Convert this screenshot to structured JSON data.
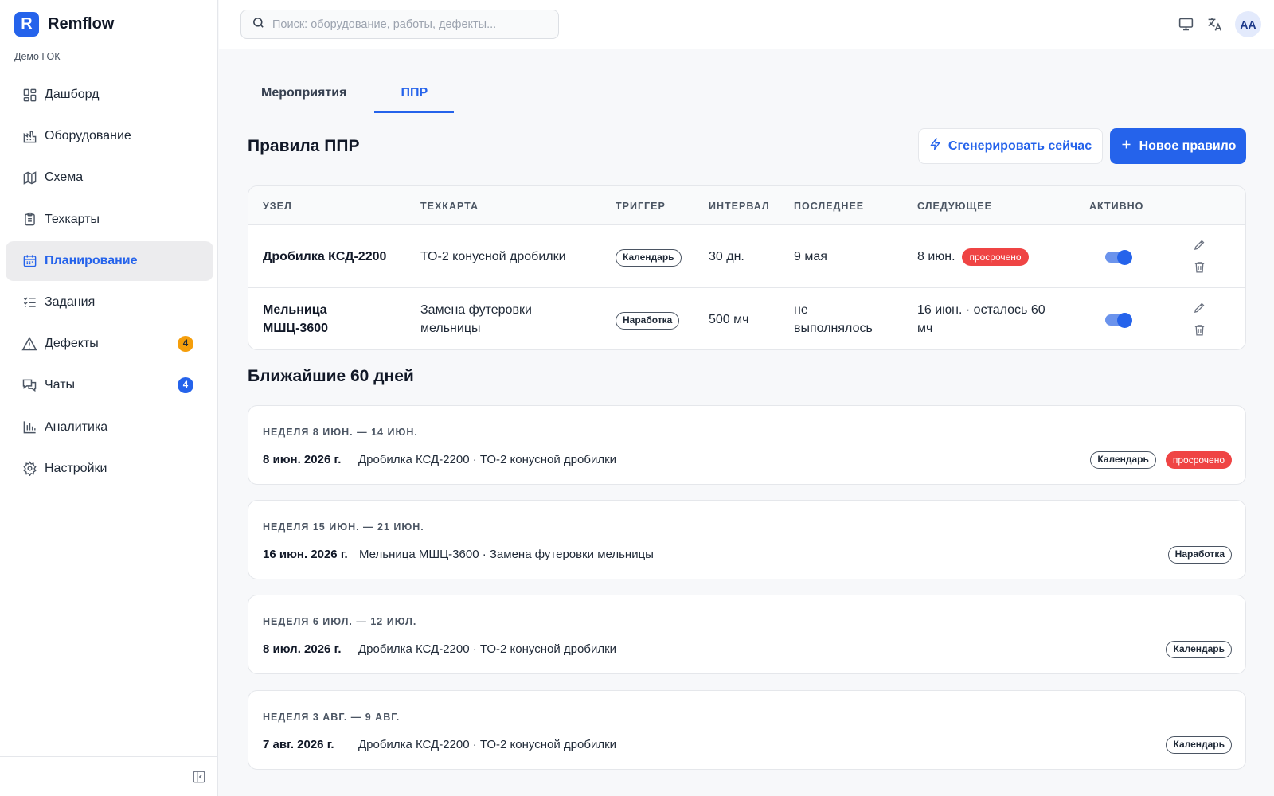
{
  "app": {
    "logo_letter": "R",
    "name": "Remflow",
    "org": "Демо ГОК"
  },
  "sidebar": {
    "items": [
      {
        "label": "Дашборд",
        "icon": "dashboard-icon"
      },
      {
        "label": "Оборудование",
        "icon": "factory-icon"
      },
      {
        "label": "Схема",
        "icon": "map-icon"
      },
      {
        "label": "Техкарты",
        "icon": "clipboard-icon"
      },
      {
        "label": "Планирование",
        "icon": "calendar-icon",
        "active": true
      },
      {
        "label": "Задания",
        "icon": "checklist-icon"
      },
      {
        "label": "Дефекты",
        "icon": "warning-icon",
        "badge": "4"
      },
      {
        "label": "Чаты",
        "icon": "chat-icon",
        "badge": "4"
      },
      {
        "label": "Аналитика",
        "icon": "bar-chart-icon"
      },
      {
        "label": "Настройки",
        "icon": "gear-icon"
      }
    ]
  },
  "header": {
    "search_placeholder": "Поиск: оборудование, работы, дефекты...",
    "avatar_initials": "AA"
  },
  "tabs": [
    {
      "label": "Мероприятия",
      "active": false
    },
    {
      "label": "ППР",
      "active": true
    }
  ],
  "rules": {
    "title": "Правила ППР",
    "generate_button": "Сгенерировать сейчас",
    "new_button": "Новое правило",
    "columns": [
      "УЗЕЛ",
      "ТЕХКАРТА",
      "ТРИГГЕР",
      "ИНТЕРВАЛ",
      "ПОСЛЕДНЕЕ",
      "СЛЕДУЮЩЕЕ",
      "АКТИВНО"
    ],
    "rows": [
      {
        "node": "Дробилка КСД-2200",
        "techcard": "ТО-2 конусной дробилки",
        "trigger": "Календарь",
        "interval": "30 дн.",
        "last": "9 мая",
        "next": "8 июн.",
        "next_badge": "просрочено",
        "active": true
      },
      {
        "node_line1": "Мельница",
        "node_line2": "МШЦ-3600",
        "techcard_line1": "Замена футеровки",
        "techcard_line2": "мельницы",
        "trigger": "Наработка",
        "interval": "500 мч",
        "last_line1": "не",
        "last_line2": "выполнялось",
        "next_line1": "16 июн. · осталось 60",
        "next_line2": "мч",
        "active": true
      }
    ]
  },
  "upcoming": {
    "title": "Ближайшие 60 дней",
    "weeks": [
      {
        "week": "НЕДЕЛЯ 8 ИЮН. — 14 ИЮН.",
        "date": "8 июн. 2026 г.",
        "desc": "Дробилка КСД-2200 · ТО-2 конусной дробилки",
        "trigger": "Календарь",
        "status": "просрочено"
      },
      {
        "week": "НЕДЕЛЯ 15 ИЮН. — 21 ИЮН.",
        "date": "16 июн. 2026 г.",
        "desc": "Мельница МШЦ-3600 · Замена футеровки мельницы",
        "trigger": "Наработка"
      },
      {
        "week": "НЕДЕЛЯ 6 ИЮЛ. — 12 ИЮЛ.",
        "date": "8 июл. 2026 г.",
        "desc": "Дробилка КСД-2200 · ТО-2 конусной дробилки",
        "trigger": "Календарь"
      },
      {
        "week": "НЕДЕЛЯ 3 АВГ. — 9 АВГ.",
        "date": "7 авг. 2026 г.",
        "desc": "Дробилка КСД-2200 · ТО-2 конусной дробилки",
        "trigger": "Календарь"
      }
    ]
  },
  "colors": {
    "accent": "#2563eb",
    "danger": "#ef4444",
    "badge_orange": "#f59e0b"
  }
}
